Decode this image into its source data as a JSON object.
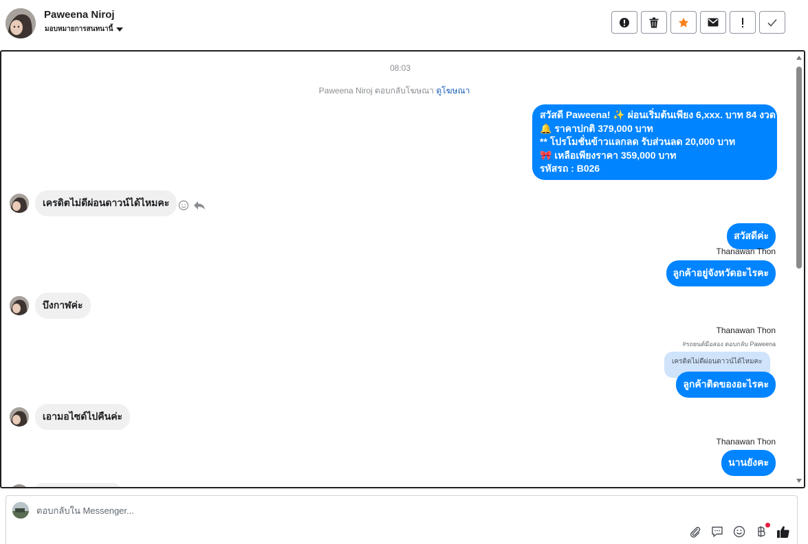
{
  "header": {
    "contact_name": "Paweena Niroj",
    "assign_label": "มอบหมายการสนทนานี้",
    "toolbar": [
      {
        "name": "mark-spam-button",
        "icon": "exclamation-circle-icon"
      },
      {
        "name": "delete-button",
        "icon": "trash-icon"
      },
      {
        "name": "star-button",
        "icon": "star-icon",
        "color": "#f5821f"
      },
      {
        "name": "mark-unread-button",
        "icon": "envelope-icon"
      },
      {
        "name": "follow-up-button",
        "icon": "exclamation-icon"
      },
      {
        "name": "mark-done-button",
        "icon": "check-icon"
      }
    ]
  },
  "conversation": {
    "timestamp": "08:03",
    "ad_reply_text": "Paweena Niroj ตอบกลับโฆษณา",
    "ad_reply_link": "ดูโฆษณา",
    "promo_lines": [
      "สวัสดี Paweena! ✨  ผ่อนเริ่มต้นเพียง 6,xxx. บาท 84 งวด",
      "🔔  ราคาปกติ 379,000 บาท",
      "** โปรโมชั่นข้าวแลกลด รับส่วนลด 20,000 บาท",
      "🎀  เหลือเพียงราคา 359,000 บาท",
      " รหัสรถ : B026"
    ],
    "incoming": [
      "เครดิตไม่ดีผ่อนดาวน์ได้ไหมคะ",
      "บึงกาฬค่ะ",
      "เอามอไซด์ไปคืนค่ะ"
    ],
    "outgoing": [
      "สวัสดีค่ะ",
      "ลูกค้าอยู่จังหวัดอะไรคะ",
      "ลูกค้าติดของอะไรคะ",
      "นานยังคะ"
    ],
    "agent_name": "Thanawan Thon",
    "reply_note": "#รถยนต์มือสอง ตอบกลับ Paweena",
    "quoted_text": "เครดิตไม่ดีผ่อนดาวน์ได้ไหมคะ"
  },
  "composer": {
    "placeholder": "ตอบกลับใน Messenger...",
    "tools": [
      "attachment-icon",
      "saved-reply-icon",
      "emoji-icon",
      "baht-payment-icon",
      "thumbs-up-icon"
    ]
  },
  "colors": {
    "outgoing_bubble": "#0084ff",
    "incoming_bubble": "#f0f0f0",
    "star": "#f5821f",
    "notification_dot": "#e41e3f"
  }
}
